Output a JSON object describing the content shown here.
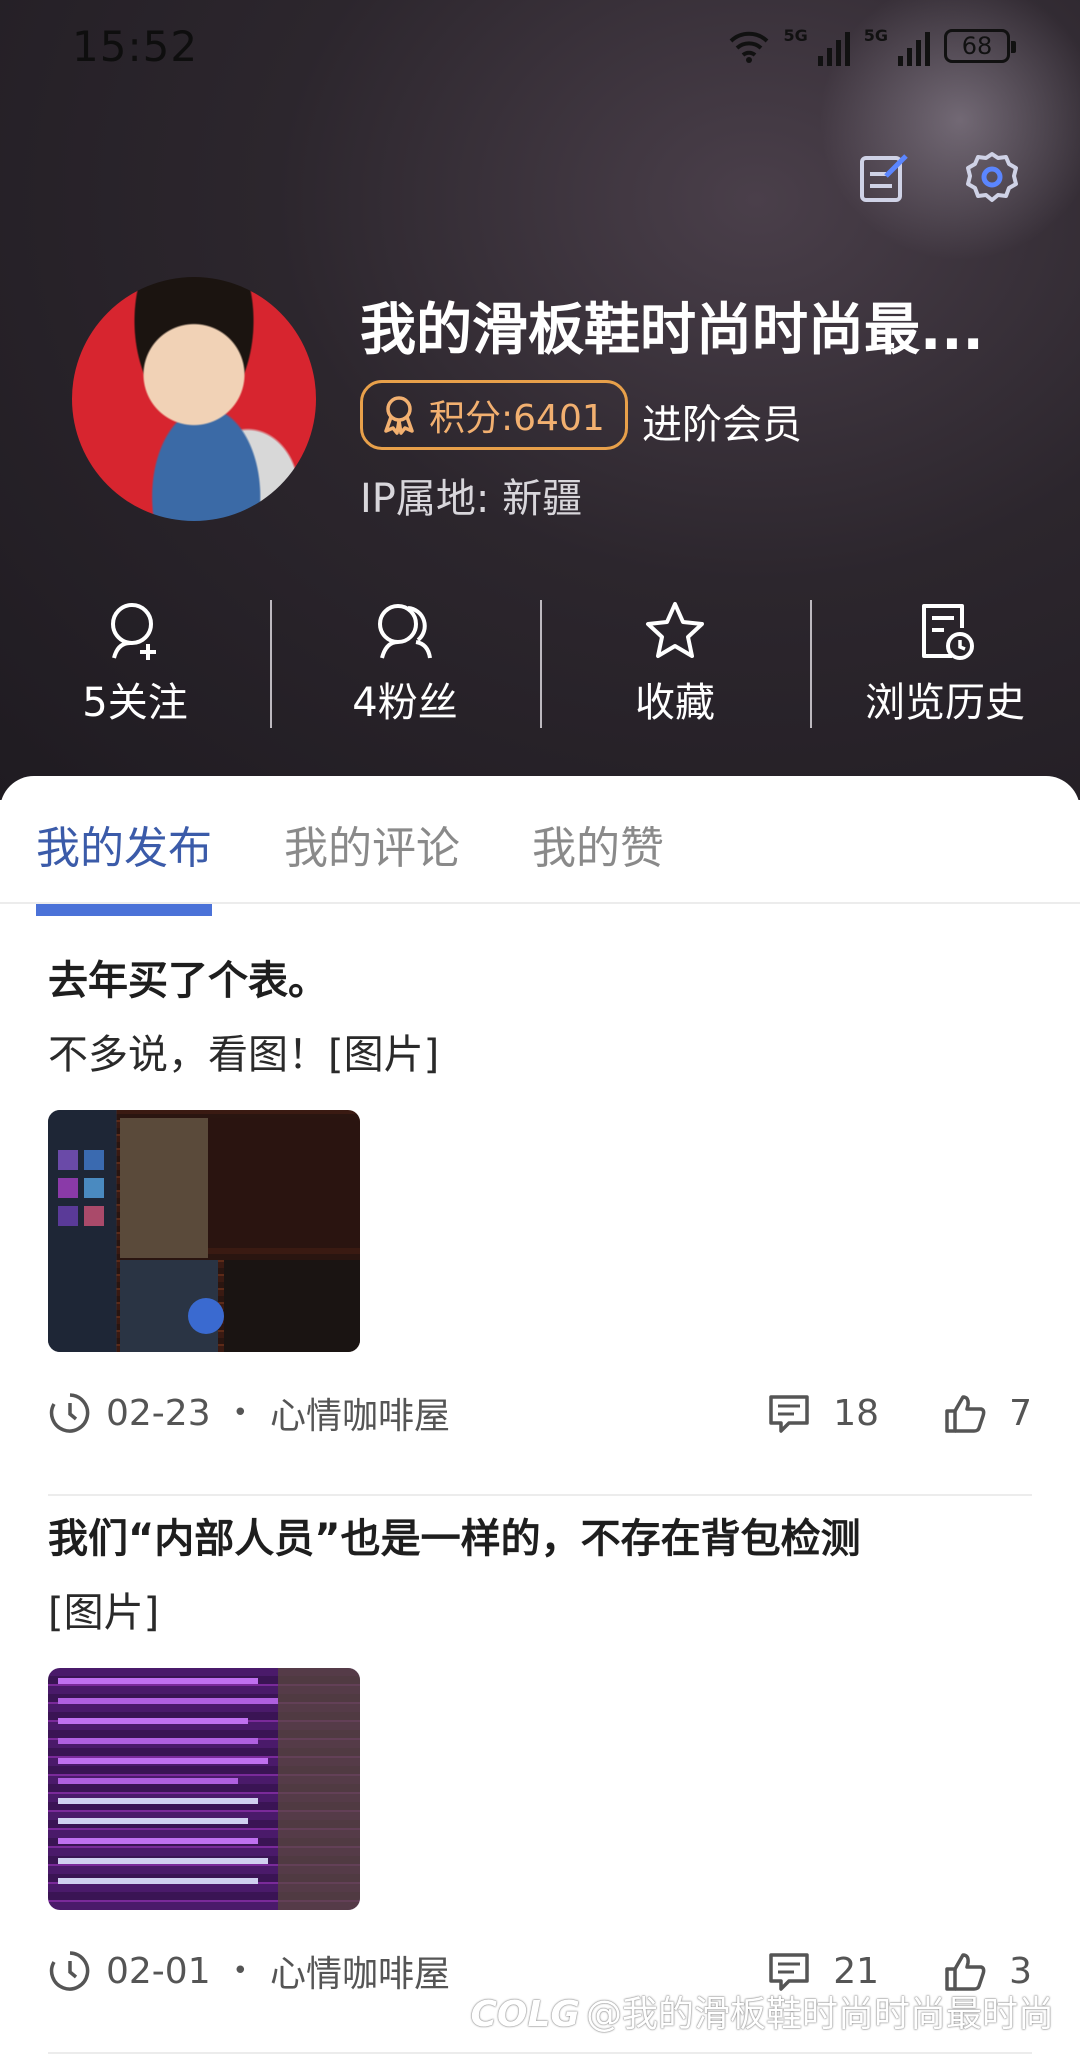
{
  "status_bar": {
    "time": "15:52",
    "network_label_1": "5G",
    "network_label_2": "5G",
    "battery": "68"
  },
  "profile": {
    "name": "我的滑板鞋时尚时尚最...",
    "points_label": "积分:6401",
    "member_level": "进阶会员",
    "ip_location": "IP属地: 新疆"
  },
  "stats": [
    {
      "label": "5关注",
      "icon": "follow-icon"
    },
    {
      "label": "4粉丝",
      "icon": "fans-icon"
    },
    {
      "label": "收藏",
      "icon": "star-icon"
    },
    {
      "label": "浏览历史",
      "icon": "history-icon"
    }
  ],
  "tabs": [
    {
      "label": "我的发布",
      "active": true
    },
    {
      "label": "我的评论",
      "active": false
    },
    {
      "label": "我的赞",
      "active": false
    }
  ],
  "posts": [
    {
      "title": "去年买了个表。",
      "body": "不多说，看图！[图片]",
      "date": "02-23",
      "board": "心情咖啡屋",
      "comments": "18",
      "likes": "7"
    },
    {
      "title": "我们“内部人员”也是一样的，不存在背包检测",
      "body": "[图片]",
      "date": "02-01",
      "board": "心情咖啡屋",
      "comments": "21",
      "likes": "3"
    }
  ],
  "watermark": "@我的滑板鞋时尚时尚最时尚",
  "watermark_logo": "COLG",
  "colors": {
    "accent": "#3b5ba9",
    "badge": "#e8a04a",
    "header_bg": "#2c262d"
  }
}
